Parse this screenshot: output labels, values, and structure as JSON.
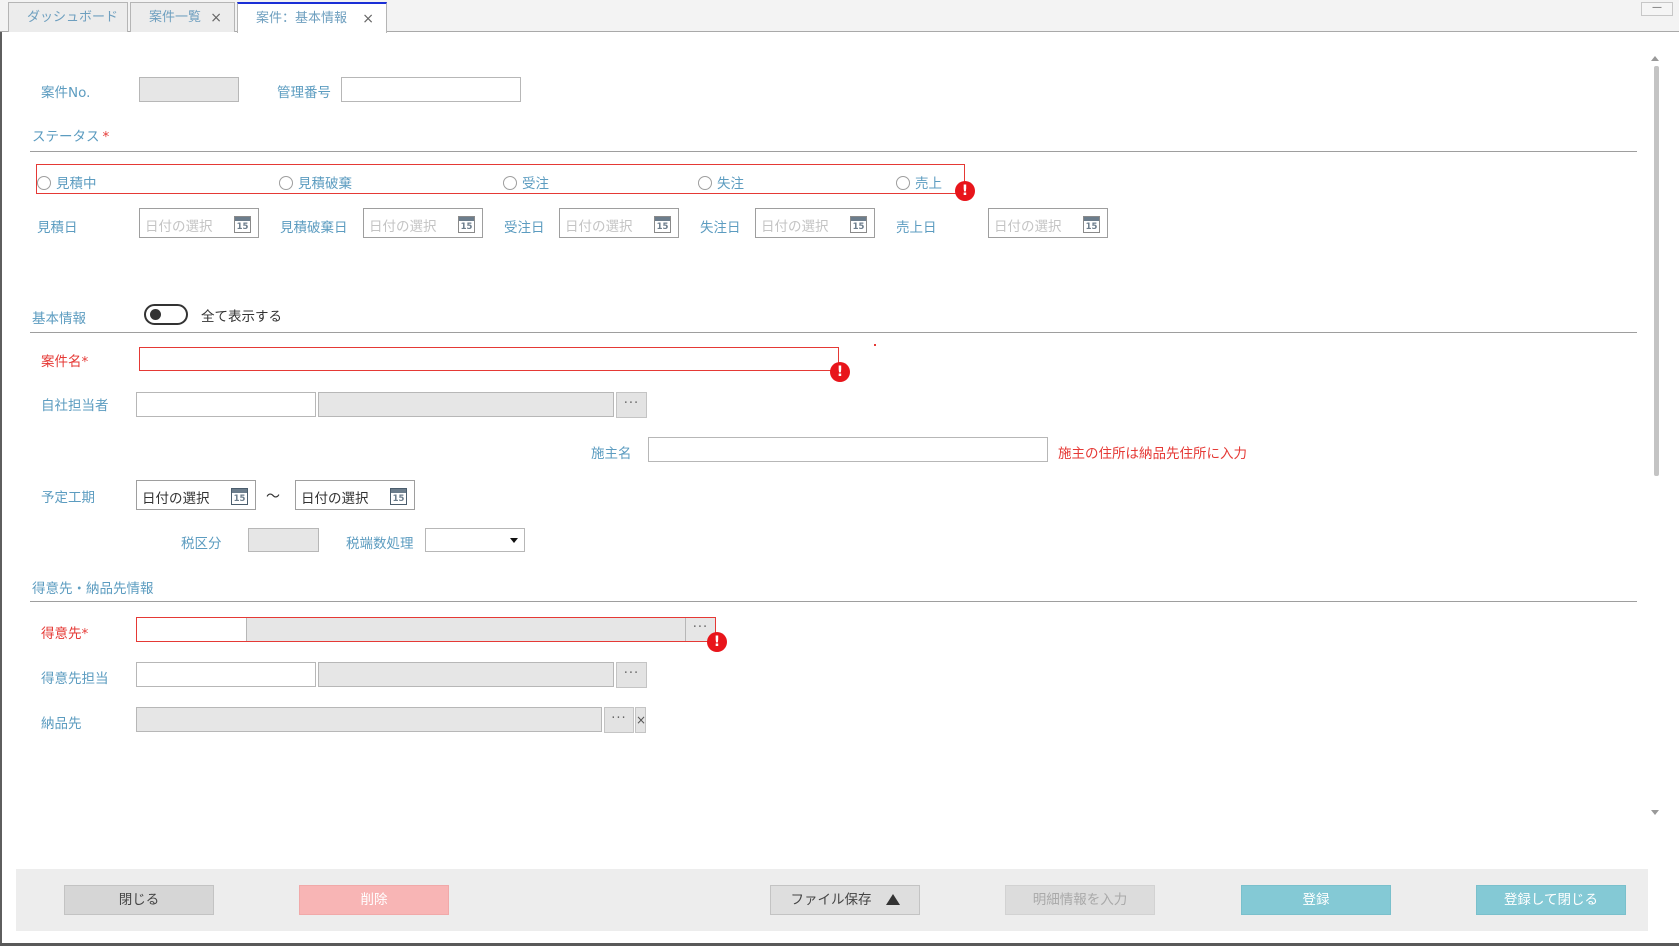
{
  "tabs": [
    {
      "label": "ダッシュボード"
    },
    {
      "label": "案件一覧",
      "close": "×"
    },
    {
      "label": "案件：基本情報",
      "close": "×"
    }
  ],
  "window": {
    "minimize": "—"
  },
  "header": {
    "case_no_label": "案件No.",
    "mgmt_no_label": "管理番号"
  },
  "status": {
    "section_label": "ステータス",
    "required_mark": "*",
    "options": [
      "見積中",
      "見積破棄",
      "受注",
      "失注",
      "売上"
    ],
    "error_icon": "!"
  },
  "dates": {
    "placeholder": "日付の選択",
    "cal_day": "15",
    "labels": [
      "見積日",
      "見積破棄日",
      "受注日",
      "失注日",
      "売上日"
    ]
  },
  "basic": {
    "section_label": "基本情報",
    "toggle_label": "全て表示する",
    "case_name_label": "案件名",
    "required_mark": "*",
    "staff_label": "自社担当者",
    "dots": "···",
    "owner_label": "施主名",
    "owner_note": "施主の住所は納品先住所に入力",
    "period_label": "予定工期",
    "period_start": "日付の選択",
    "period_sep": "〜",
    "period_end": "日付の選択",
    "tax_category_label": "税区分",
    "tax_rounding_label": "税端数処理"
  },
  "customer": {
    "section_label": "得意先・納品先情報",
    "customer_label": "得意先",
    "required_mark": "*",
    "customer_contact_label": "得意先担当",
    "delivery_label": "納品先",
    "clear": "×"
  },
  "footer": {
    "close": "閉じる",
    "delete": "削除",
    "file_save": "ファイル保存",
    "detail_input": "明細情報を入力",
    "register": "登録",
    "register_close": "登録して閉じる"
  },
  "colors": {
    "label": "#5c9cc0",
    "required": "#e53935",
    "active_tab": "#1a2fd6",
    "primary_button": "#84c9d5",
    "delete_button": "#f8b5b5"
  }
}
